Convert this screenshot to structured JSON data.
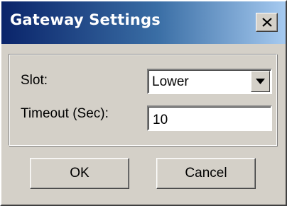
{
  "window": {
    "title": "Gateway Settings",
    "close_icon": "close-x-icon"
  },
  "form": {
    "slot_label": "Slot:",
    "slot_value": "Lower",
    "timeout_label": "Timeout (Sec):",
    "timeout_value": "10"
  },
  "buttons": {
    "ok_label": "OK",
    "cancel_label": "Cancel"
  },
  "colors": {
    "titlebar_start": "#0a246a",
    "titlebar_end": "#a6caf0",
    "face": "#d4d0c8"
  }
}
